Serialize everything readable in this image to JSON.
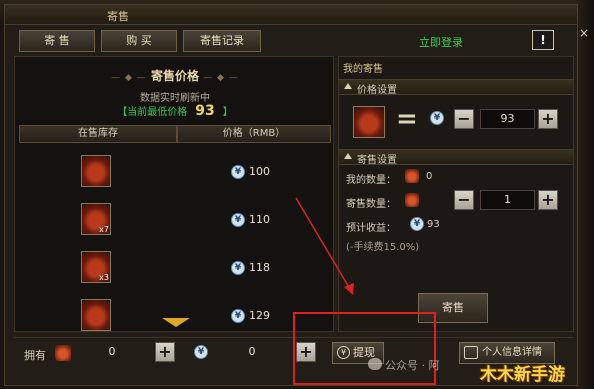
{
  "window": {
    "title": "寄售",
    "close_glyph": "×"
  },
  "tabs": [
    {
      "label": "寄 售"
    },
    {
      "label": "购 买"
    },
    {
      "label": "寄售记录"
    }
  ],
  "header": {
    "login_link": "立即登录",
    "help_label": "!"
  },
  "left_panel": {
    "heading": "寄售价格",
    "heading_ornament": "— ◆ —",
    "realtime_text": "数据实时刷新中",
    "lowest_prefix": "【当前最低价格",
    "lowest_value": "93",
    "lowest_suffix": "】",
    "columns": [
      "在售库存",
      "价格（RMB）"
    ],
    "rows": [
      {
        "qty": "",
        "price": "100"
      },
      {
        "qty": "x7",
        "price": "110"
      },
      {
        "qty": "x3",
        "price": "118"
      },
      {
        "qty": "",
        "price": "129"
      }
    ],
    "coin_glyph": "¥"
  },
  "right_panel": {
    "title": "我的寄售",
    "price_section": "价格设置",
    "equals": "=",
    "price_value": "93",
    "sell_section": "寄售设置",
    "my_qty_label": "我的数量：",
    "my_qty_value": "0",
    "sell_qty_label": "寄售数量：",
    "sell_qty_value": "1",
    "expected_label": "预计收益：",
    "expected_value": "93",
    "fee_note": "(-手续费15.0%)",
    "sell_button": "寄售",
    "minus_glyph": "−",
    "plus_glyph": "+"
  },
  "bottom": {
    "own_label": "拥有",
    "own_value": "0",
    "money_value": "0",
    "withdraw_label": "提现",
    "profile_label": "个人信息详情"
  },
  "overlay": {
    "watermark_text": "公众号 · 阿",
    "site_mark": "木木新手游"
  },
  "colors": {
    "accent_green": "#2ecf40",
    "price_gold": "#f0d860",
    "annotation_red": "#e0201a"
  }
}
